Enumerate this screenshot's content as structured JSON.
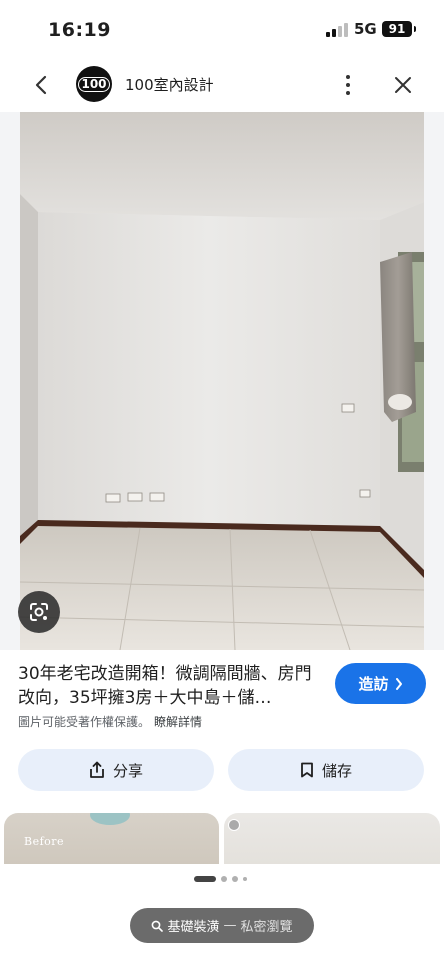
{
  "status_bar": {
    "time": "16:19",
    "network": "5G",
    "battery": "91"
  },
  "header": {
    "logo_text": "100",
    "site_name": "100室內設計"
  },
  "image": {
    "title": "30年老宅改造開箱！微調隔間牆、房門改向，35坪擁3房＋大中島＋儲…",
    "visit_label": "造訪",
    "copyright_note": "圖片可能受著作權保護。",
    "learn_more": "瞭解詳情"
  },
  "actions": {
    "share_label": "分享",
    "save_label": "儲存"
  },
  "related": {
    "thumb1_caption": "Before"
  },
  "private_browsing": {
    "query": "基礎裝潢",
    "separator": "—",
    "mode_label": "私密瀏覽"
  },
  "colors": {
    "accent": "#1a73e8",
    "pill_bg": "#e8effa"
  },
  "icons": [
    "back-arrow-icon",
    "more-vert-icon",
    "close-icon",
    "lens-icon",
    "share-icon",
    "bookmark-icon",
    "chevron-right-icon",
    "search-icon"
  ]
}
